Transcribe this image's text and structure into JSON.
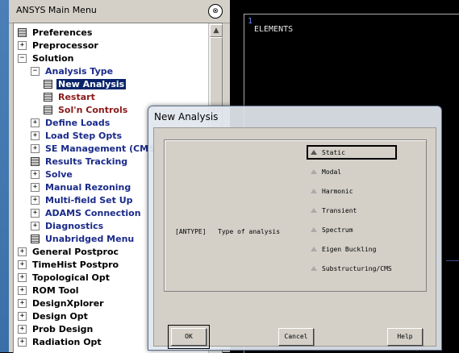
{
  "main_menu": {
    "title": "ANSYS Main Menu",
    "collapse_glyph": "⊗",
    "items": [
      {
        "label": "Preferences",
        "type": "doc",
        "indent": 0,
        "color": "black"
      },
      {
        "label": "Preprocessor",
        "type": "plus",
        "indent": 0,
        "color": "black"
      },
      {
        "label": "Solution",
        "type": "minus",
        "indent": 0,
        "color": "black"
      },
      {
        "label": "Analysis Type",
        "type": "minus",
        "indent": 1,
        "color": "blue"
      },
      {
        "label": "New Analysis",
        "type": "doc",
        "indent": 2,
        "color": "black",
        "selected": true
      },
      {
        "label": "Restart",
        "type": "doc",
        "indent": 2,
        "color": "maroon"
      },
      {
        "label": "Sol'n Controls",
        "type": "doc",
        "indent": 2,
        "color": "maroon"
      },
      {
        "label": "Define Loads",
        "type": "plus",
        "indent": 1,
        "color": "blue"
      },
      {
        "label": "Load Step Opts",
        "type": "plus",
        "indent": 1,
        "color": "blue"
      },
      {
        "label": "SE Management (CMS)",
        "type": "plus",
        "indent": 1,
        "color": "blue"
      },
      {
        "label": "Results Tracking",
        "type": "doc",
        "indent": 1,
        "color": "blue"
      },
      {
        "label": "Solve",
        "type": "plus",
        "indent": 1,
        "color": "blue"
      },
      {
        "label": "Manual Rezoning",
        "type": "plus",
        "indent": 1,
        "color": "blue"
      },
      {
        "label": "Multi-field Set Up",
        "type": "plus",
        "indent": 1,
        "color": "blue"
      },
      {
        "label": "ADAMS Connection",
        "type": "plus",
        "indent": 1,
        "color": "blue"
      },
      {
        "label": "Diagnostics",
        "type": "plus",
        "indent": 1,
        "color": "blue"
      },
      {
        "label": "Unabridged Menu",
        "type": "doc",
        "indent": 1,
        "color": "blue"
      },
      {
        "label": "General Postproc",
        "type": "plus",
        "indent": 0,
        "color": "black"
      },
      {
        "label": "TimeHist Postpro",
        "type": "plus",
        "indent": 0,
        "color": "black"
      },
      {
        "label": "Topological Opt",
        "type": "plus",
        "indent": 0,
        "color": "black"
      },
      {
        "label": "ROM Tool",
        "type": "plus",
        "indent": 0,
        "color": "black"
      },
      {
        "label": "DesignXplorer",
        "type": "plus",
        "indent": 0,
        "color": "black"
      },
      {
        "label": "Design Opt",
        "type": "plus",
        "indent": 0,
        "color": "black"
      },
      {
        "label": "Prob Design",
        "type": "plus",
        "indent": 0,
        "color": "black"
      },
      {
        "label": "Radiation Opt",
        "type": "plus",
        "indent": 0,
        "color": "black"
      }
    ]
  },
  "graphics": {
    "window_number": "1",
    "label": "ELEMENTS"
  },
  "dialog": {
    "title": "New Analysis",
    "field_tag": "[ANTYPE]",
    "field_label": "Type of analysis",
    "options": [
      "Static",
      "Modal",
      "Harmonic",
      "Transient",
      "Spectrum",
      "Eigen Buckling",
      "Substructuring/CMS"
    ],
    "selected_option": "Static",
    "ok_label": "OK",
    "cancel_label": "Cancel",
    "help_label": "Help"
  },
  "colors": {
    "selected_bg": "#0a246a",
    "blue_text": "#1a2a8a",
    "maroon_text": "#8b1a1a",
    "graphics_bg": "#000000"
  }
}
